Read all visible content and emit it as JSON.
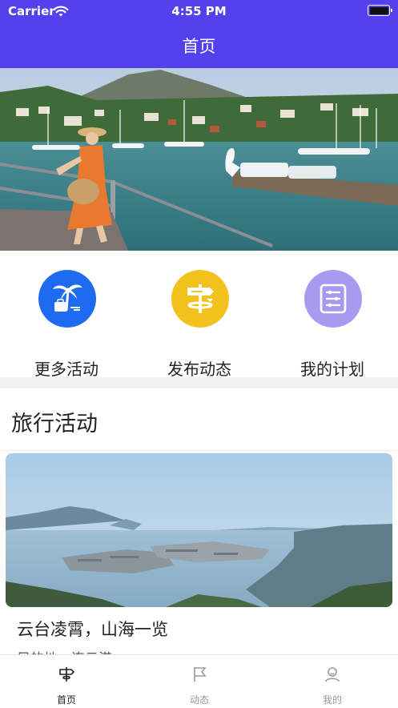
{
  "status_bar": {
    "carrier": "Carrier",
    "time": "4:55 PM"
  },
  "nav": {
    "title": "首页"
  },
  "banner": {
    "alt": "travel photo"
  },
  "menu": {
    "items": [
      {
        "label": "更多活动",
        "icon": "palm-suitcase-icon",
        "color": "#1f6bf0"
      },
      {
        "label": "发布动态",
        "icon": "signpost-icon",
        "color": "#f0c21b"
      },
      {
        "label": "我的计划",
        "icon": "list-icon",
        "color": "#a79bf1"
      }
    ]
  },
  "section": {
    "title": "旅行活动"
  },
  "card": {
    "title": "云台凌霄，山海一览",
    "subtitle": "目的地：连云港"
  },
  "tabs": [
    {
      "label": "首页",
      "icon": "signpost-tab-icon",
      "active": true
    },
    {
      "label": "动态",
      "icon": "flag-icon",
      "active": false
    },
    {
      "label": "我的",
      "icon": "person-icon",
      "active": false
    }
  ],
  "colors": {
    "primary": "#5341ee",
    "tab_active": "#222222",
    "tab_inactive": "#9a9a9a"
  }
}
